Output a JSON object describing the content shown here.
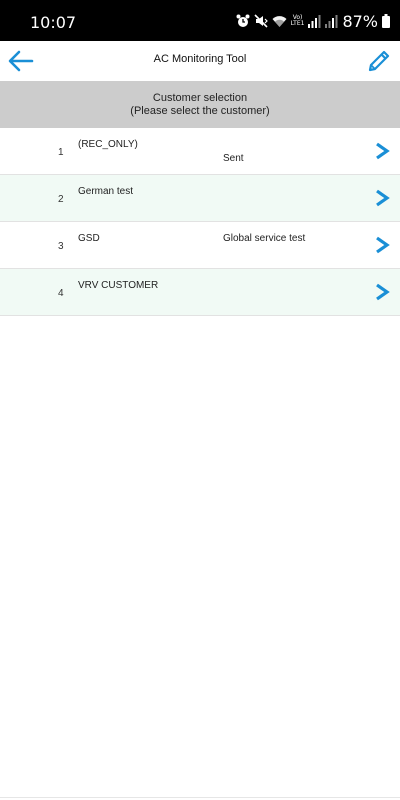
{
  "status_bar": {
    "time": "10:07",
    "volte_top": "Vo)",
    "volte_bottom": "LTE1",
    "battery": "87%"
  },
  "app_bar": {
    "title": "AC Monitoring Tool",
    "back_icon": "arrow-left-icon",
    "edit_icon": "pencil-icon"
  },
  "section": {
    "line1": "Customer selection",
    "line2": "(Please select the customer)"
  },
  "customers": [
    {
      "index": "1",
      "name": "(REC_ONLY)",
      "detail": "Sent"
    },
    {
      "index": "2",
      "name": "German test",
      "detail": ""
    },
    {
      "index": "3",
      "name": "GSD",
      "detail": "Global service test"
    },
    {
      "index": "4",
      "name": "VRV CUSTOMER",
      "detail": ""
    }
  ],
  "colors": {
    "accent": "#1a8fd6",
    "header_bg": "#cccccc",
    "alt_row_bg": "#f1faf5"
  }
}
